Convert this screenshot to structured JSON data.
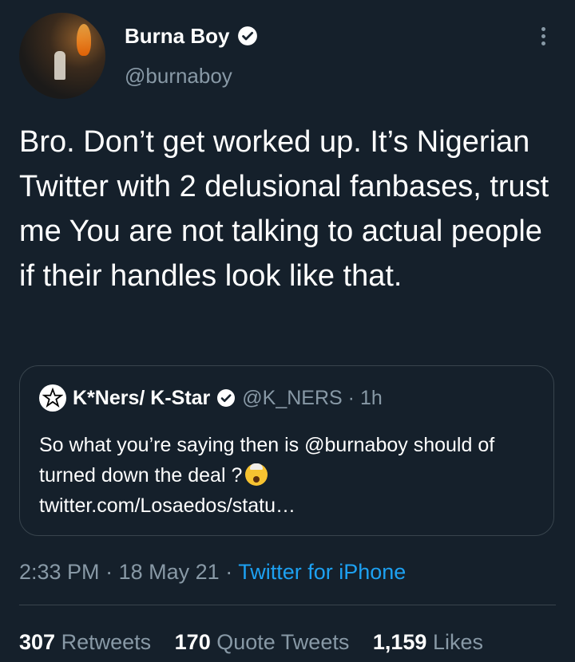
{
  "author": {
    "display_name": "Burna Boy",
    "handle": "@burnaboy",
    "avatar_icon": "profile-photo",
    "verified_icon": "verified-badge-icon"
  },
  "tweet": {
    "text": "Bro. Don’t get worked up. It’s Nigerian Twitter with 2 delusional fanbases, trust me You are not talking to actual people if their handles look like that."
  },
  "quoted_tweet": {
    "display_name": "K*Ners/ K-Star",
    "handle": "@K_NERS",
    "separator": "·",
    "time": "1h",
    "text": "So what you’re saying then is @burnaboy should of turned down the deal ?",
    "emoji_icon": "exploding-head-emoji",
    "link": "twitter.com/Losaedos/statu…"
  },
  "meta": {
    "time": "2:33 PM",
    "sep1": "·",
    "date": "18 May 21",
    "sep2": "·",
    "source": "Twitter for iPhone"
  },
  "stats": {
    "retweets_count": "307",
    "retweets_label": "Retweets",
    "quotes_count": "170",
    "quotes_label": "Quote Tweets",
    "likes_count": "1,159",
    "likes_label": "Likes"
  },
  "colors": {
    "background": "#15202b",
    "accent": "#1da1f2",
    "secondary_text": "#8899a6",
    "border": "#38444d"
  }
}
